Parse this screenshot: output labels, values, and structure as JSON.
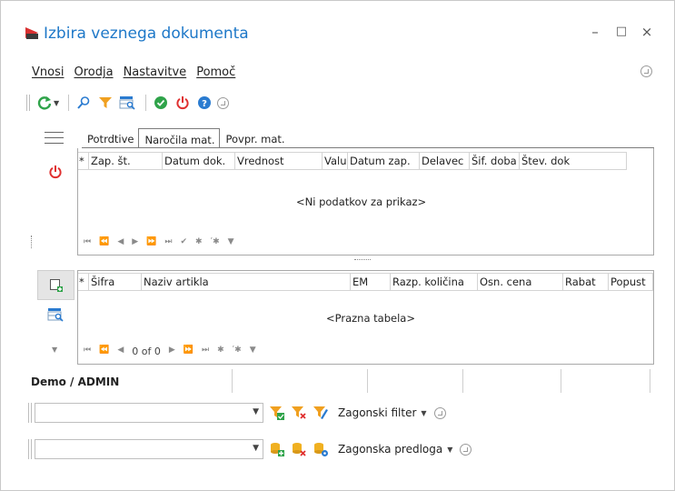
{
  "window": {
    "title": "Izbira veznega dokumenta",
    "controls": {
      "minimize": "–",
      "maximize": "□",
      "close": "×"
    }
  },
  "menu": [
    {
      "label": "Vnosi"
    },
    {
      "label": "Orodja"
    },
    {
      "label": "Nastavitve"
    },
    {
      "label": "Pomoč"
    }
  ],
  "toolbar": {
    "icons": [
      "refresh-icon",
      "search-icon",
      "filter-icon",
      "grid-search-icon",
      "confirm-icon",
      "power-icon",
      "help-icon",
      "expand-icon"
    ],
    "colors": {
      "green": "#2fa34a",
      "orange": "#f0a020",
      "red": "#e03030",
      "blue": "#2a7bd0"
    }
  },
  "tabs": [
    {
      "label": "Potrdtive",
      "active": false
    },
    {
      "label": "Naročila mat.",
      "active": true
    },
    {
      "label": "Povpr. mat.",
      "active": false
    }
  ],
  "top_grid": {
    "columns": [
      "*",
      "Zap. št.",
      "Datum dok.",
      "Vrednost",
      "Valu",
      "Datum zap.",
      "Delavec",
      "Šif. doba",
      "Štev. dok"
    ],
    "empty_text": "<Ni podatkov za prikaz>"
  },
  "bottom_grid": {
    "columns": [
      "*",
      "Šifra",
      "Naziv artikla",
      "EM",
      "Razp. količina",
      "Osn. cena",
      "Rabat",
      "Popust"
    ],
    "empty_text": "<Prazna tabela>",
    "record_counter": "0 of 0"
  },
  "status": {
    "user": "Demo / ADMIN"
  },
  "filter_row": {
    "value": "",
    "label": "Zagonski filter"
  },
  "template_row": {
    "value": "",
    "label": "Zagonska predloga"
  }
}
